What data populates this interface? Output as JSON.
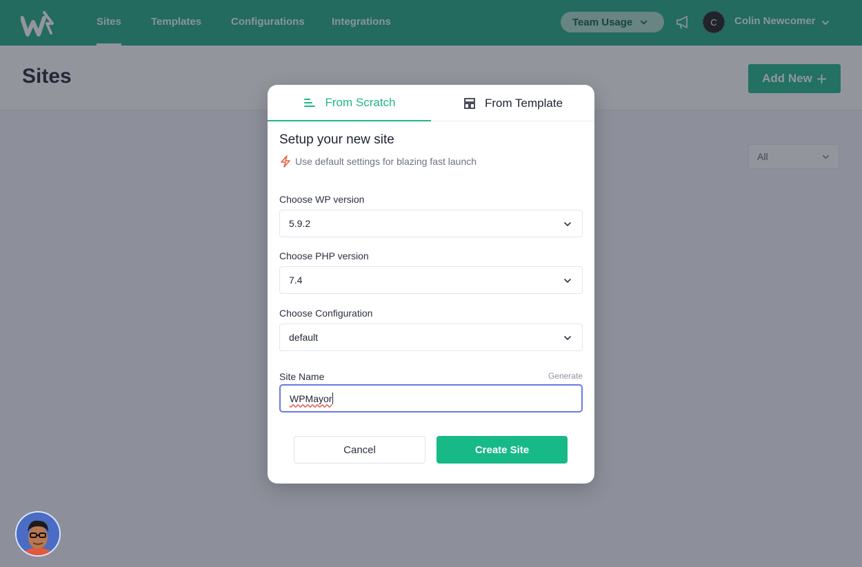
{
  "nav": {
    "items": [
      {
        "label": "Sites"
      },
      {
        "label": "Templates"
      },
      {
        "label": "Configurations"
      },
      {
        "label": "Integrations"
      }
    ],
    "team_usage": "Team Usage",
    "avatar_initial": "C",
    "user_name": "Colin Newcomer"
  },
  "page": {
    "title": "Sites",
    "add_new": "Add New",
    "filter_value": "All"
  },
  "modal": {
    "tabs": [
      {
        "label": "From Scratch",
        "icon": "bars-left-icon"
      },
      {
        "label": "From Template",
        "icon": "layout-template-icon"
      }
    ],
    "title": "Setup your new site",
    "subtitle": "Use default settings for blazing fast launch",
    "wp_label": "Choose WP version",
    "wp_value": "5.9.2",
    "php_label": "Choose PHP version",
    "php_value": "7.4",
    "config_label": "Choose Configuration",
    "config_value": "default",
    "site_name_label": "Site Name",
    "generate_label": "Generate",
    "site_name_value": "WPMayor",
    "cancel_label": "Cancel",
    "create_label": "Create Site"
  },
  "colors": {
    "brand": "#1cb789",
    "focus": "#6a78e8"
  }
}
